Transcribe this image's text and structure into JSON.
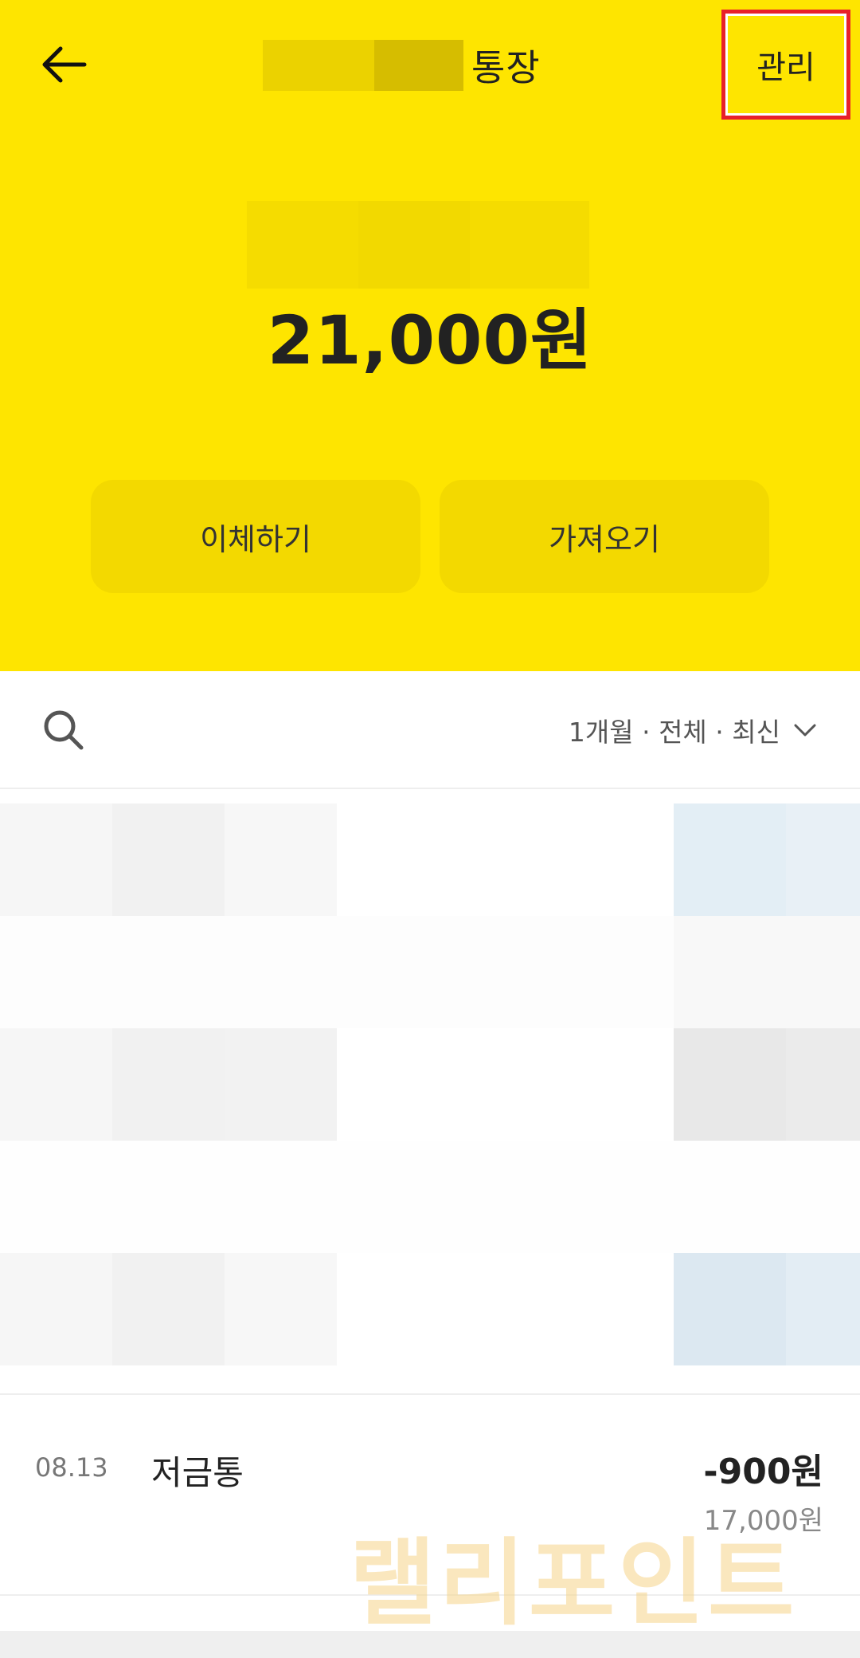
{
  "header": {
    "title_suffix": "통장",
    "manage_label": "관리",
    "balance": "21,000원",
    "colors": {
      "accent": "#FEE500",
      "highlight_box": "#E8202A"
    }
  },
  "actions": {
    "transfer_label": "이체하기",
    "fetch_label": "가져오기"
  },
  "filter": {
    "label": "1개월 · 전체 · 최신"
  },
  "transaction": {
    "date": "08.13",
    "name": "저금통",
    "amount": "-900원",
    "balance_after": "17,000원"
  },
  "watermark": {
    "text": "랠리포인트"
  },
  "icons": {
    "back": "arrow-left-icon",
    "search": "search-icon",
    "filter": "chevron-down-icon"
  }
}
